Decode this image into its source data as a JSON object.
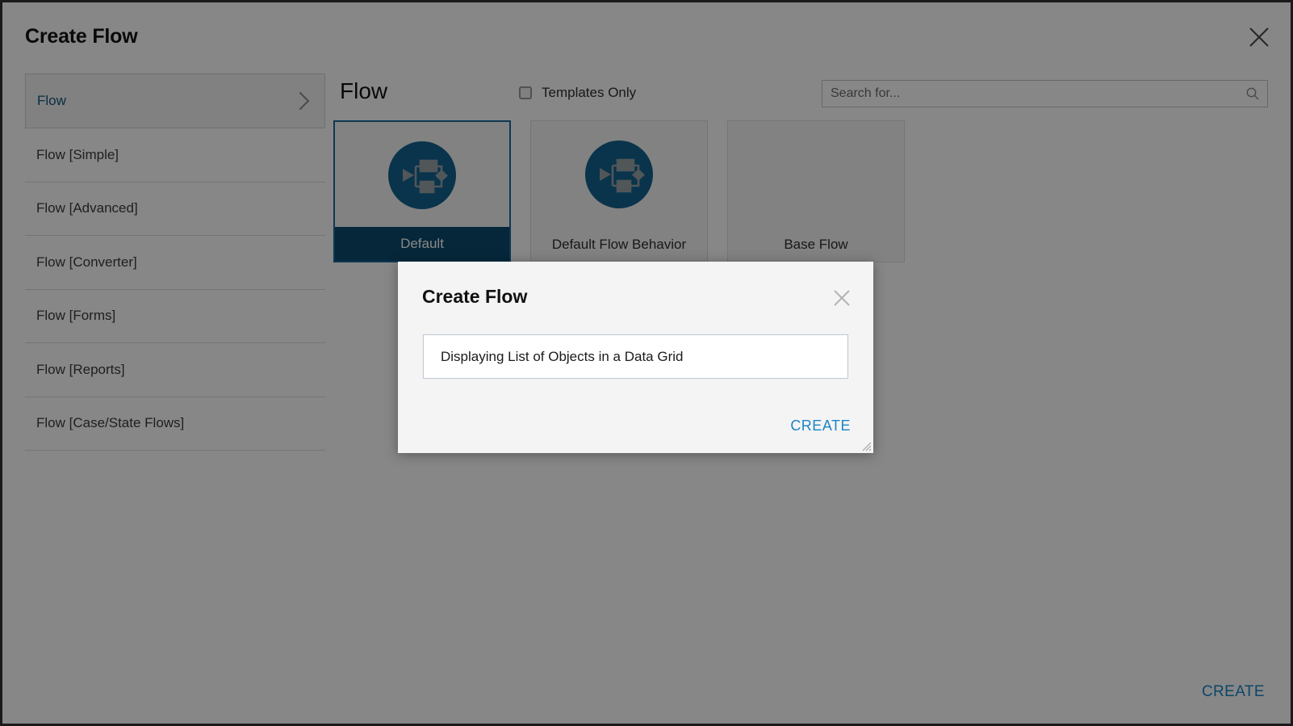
{
  "window": {
    "title": "Create Flow",
    "close_icon": "close-icon"
  },
  "sidebar": {
    "items": [
      {
        "label": "Flow",
        "selected": true,
        "chevron": "chevron-right-icon"
      },
      {
        "label": "Flow [Simple]",
        "selected": false
      },
      {
        "label": "Flow [Advanced]",
        "selected": false
      },
      {
        "label": "Flow [Converter]",
        "selected": false
      },
      {
        "label": "Flow [Forms]",
        "selected": false
      },
      {
        "label": "Flow [Reports]",
        "selected": false
      },
      {
        "label": "Flow [Case/State Flows]",
        "selected": false
      }
    ]
  },
  "content": {
    "title": "Flow",
    "templates_only": {
      "label": "Templates Only",
      "checked": false
    },
    "search": {
      "placeholder": "Search for...",
      "value": "",
      "icon": "search-icon"
    },
    "cards": [
      {
        "label": "Default",
        "selected": true,
        "icon": "flow-diagram-icon"
      },
      {
        "label": "Default Flow Behavior",
        "selected": false,
        "icon": "flow-diagram-icon"
      },
      {
        "label": "Base Flow",
        "selected": false,
        "icon": "none"
      }
    ]
  },
  "footer": {
    "create_label": "CREATE"
  },
  "name_modal": {
    "title": "Create Flow",
    "close_icon": "close-icon",
    "input": {
      "value": "Displaying List of Objects in a Data Grid",
      "placeholder": ""
    },
    "create_label": "CREATE",
    "resize_grip": "resize-grip-icon"
  },
  "colors": {
    "accent_blue": "#1c84c6",
    "icon_blue": "#11628f",
    "selected_card_label_bg": "#0c4a6e",
    "sidebar_selected_text": "#14577d",
    "overlay": "rgba(0,0,0,0.47)"
  }
}
